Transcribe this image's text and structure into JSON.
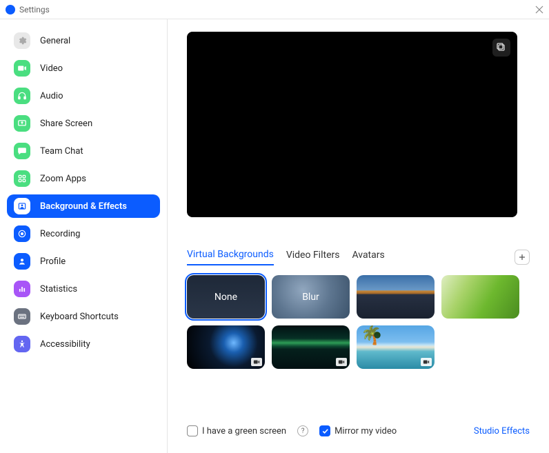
{
  "window": {
    "title": "Settings"
  },
  "sidebar": {
    "items": [
      {
        "label": "General"
      },
      {
        "label": "Video"
      },
      {
        "label": "Audio"
      },
      {
        "label": "Share Screen"
      },
      {
        "label": "Team Chat"
      },
      {
        "label": "Zoom Apps"
      },
      {
        "label": "Background & Effects"
      },
      {
        "label": "Recording"
      },
      {
        "label": "Profile"
      },
      {
        "label": "Statistics"
      },
      {
        "label": "Keyboard Shortcuts"
      },
      {
        "label": "Accessibility"
      }
    ]
  },
  "tabs": [
    {
      "label": "Virtual Backgrounds"
    },
    {
      "label": "Video Filters"
    },
    {
      "label": "Avatars"
    }
  ],
  "thumbs": {
    "none": "None",
    "blur": "Blur"
  },
  "footer": {
    "green_screen": "I have a green screen",
    "mirror": "Mirror my video",
    "studio": "Studio Effects"
  }
}
